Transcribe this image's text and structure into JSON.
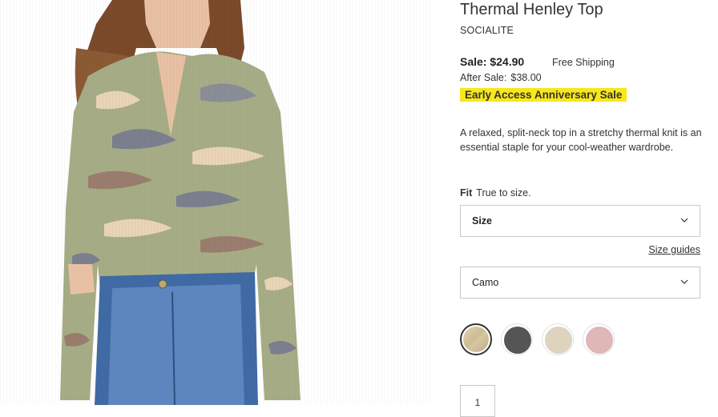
{
  "product": {
    "title": "Thermal Henley Top",
    "brand": "SOCIALITE",
    "sale_price": "Sale: $24.90",
    "shipping": "Free Shipping",
    "after_sale_label": "After Sale:",
    "after_sale_price": "$38.00",
    "promo": "Early Access Anniversary Sale",
    "promo_color": "#f8e71c",
    "description": "A relaxed, split-neck top in a stretchy thermal knit is an essential staple for your cool-weather wardrobe."
  },
  "fit": {
    "label": "Fit",
    "value": "True to size."
  },
  "size_select": {
    "value": "Size",
    "icon": "chevron-down-icon"
  },
  "size_guides": "Size guides",
  "color_select": {
    "value": "Camo",
    "icon": "chevron-down-icon"
  },
  "swatches": [
    {
      "name": "camo",
      "color": "#d9c9a3",
      "selected": true
    },
    {
      "name": "charcoal",
      "color": "#5a5a5a",
      "selected": false
    },
    {
      "name": "oatmeal",
      "color": "#ddd3bf",
      "selected": false
    },
    {
      "name": "pink",
      "color": "#e0b8b8",
      "selected": false
    }
  ],
  "quantity": "1"
}
